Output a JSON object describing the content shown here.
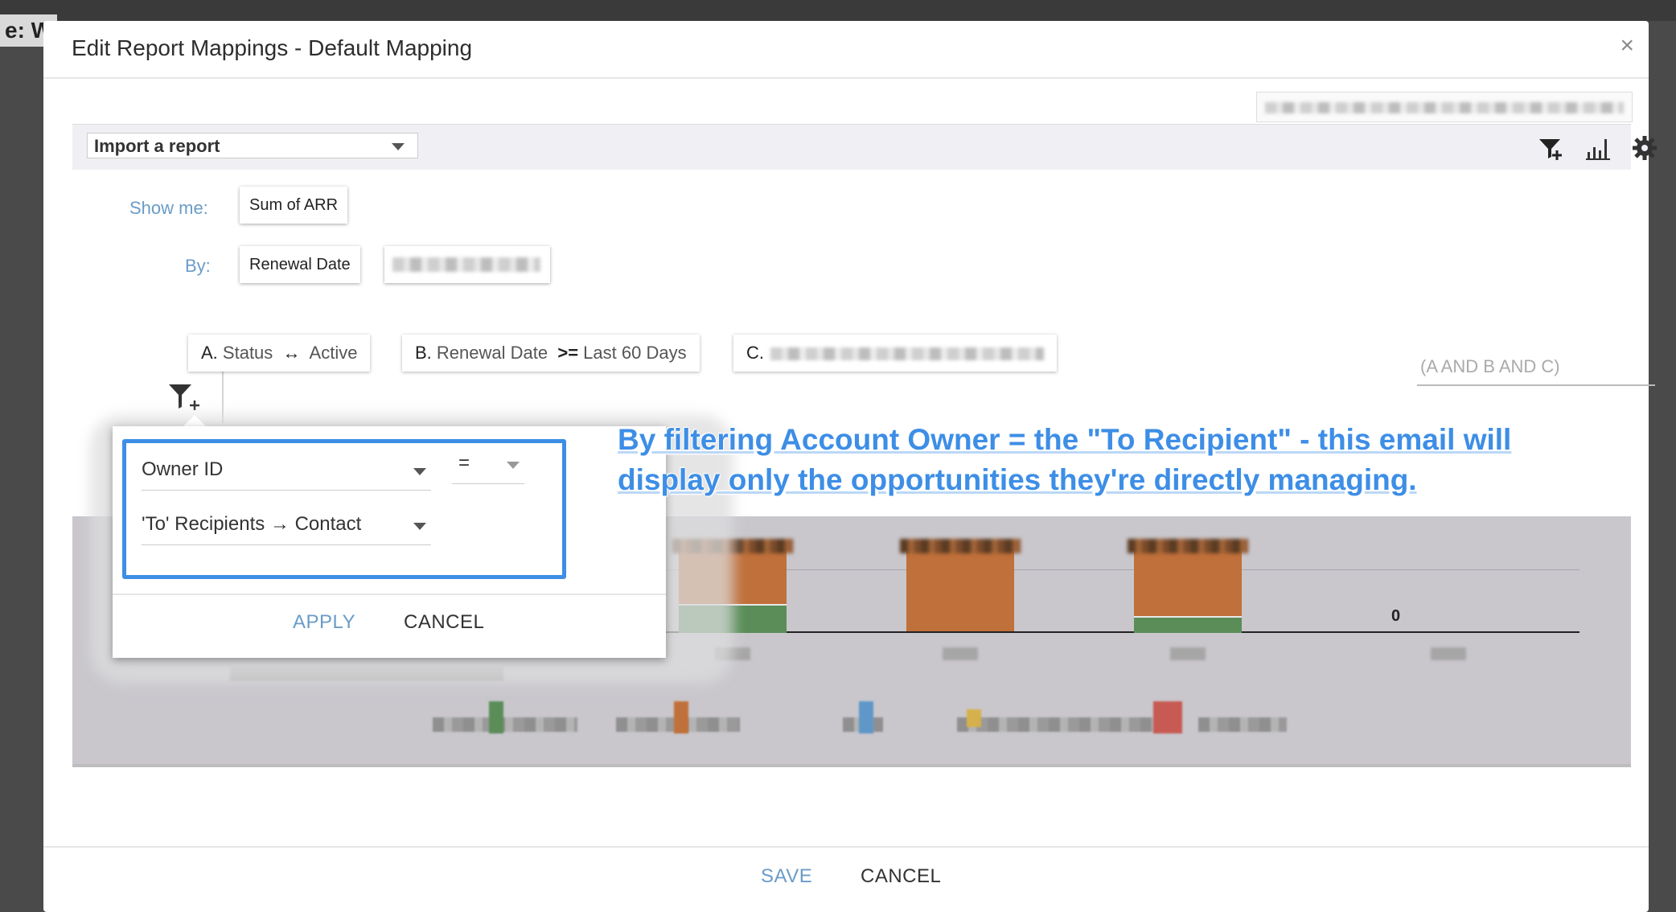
{
  "background": {
    "partial_title": "e: W"
  },
  "modal": {
    "title": "Edit Report Mappings - Default Mapping",
    "close_icon": "×"
  },
  "toolbar": {
    "import_label": "Import a report",
    "icons": [
      "filter-add-icon",
      "chart-icon",
      "gear-icon"
    ]
  },
  "report": {
    "show_me_label": "Show me:",
    "show_me_value": "Sum of ARR",
    "by_label": "By:",
    "by_value": "Renewal Date"
  },
  "filters": [
    {
      "key": "A.",
      "field": "Status",
      "op": "↔",
      "value": "Active"
    },
    {
      "key": "B.",
      "field": "Renewal Date",
      "op": ">=",
      "value": "Last 60 Days"
    },
    {
      "key": "C.",
      "field": "",
      "op": "",
      "value": ""
    }
  ],
  "filter_logic_placeholder": "(A AND B AND C)",
  "popover": {
    "field": "Owner ID",
    "operator": "=",
    "value": "'To' Recipients → Contact",
    "apply_label": "APPLY",
    "cancel_label": "CANCEL"
  },
  "annotation": {
    "line1": "By filtering Account Owner = the \"To Recipient\" - this email will",
    "line2": "display only the opportunities they're directly managing."
  },
  "chart_data": {
    "type": "bar",
    "stacked": true,
    "categories": [
      "",
      "",
      "",
      ""
    ],
    "series": [
      {
        "color": "#5a8d58",
        "values": [
          45,
          0,
          25,
          0
        ]
      },
      {
        "color": "#c0703a",
        "values": [
          95,
          140,
          115,
          0
        ]
      }
    ],
    "data_labels": [
      "",
      "",
      "",
      "0"
    ]
  },
  "footer": {
    "save_label": "SAVE",
    "cancel_label": "CANCEL"
  },
  "colors": {
    "accent": "#3d8ee6",
    "link": "#6a9cc7",
    "bar_orange": "#c0703a",
    "bar_green": "#5a8d58"
  }
}
